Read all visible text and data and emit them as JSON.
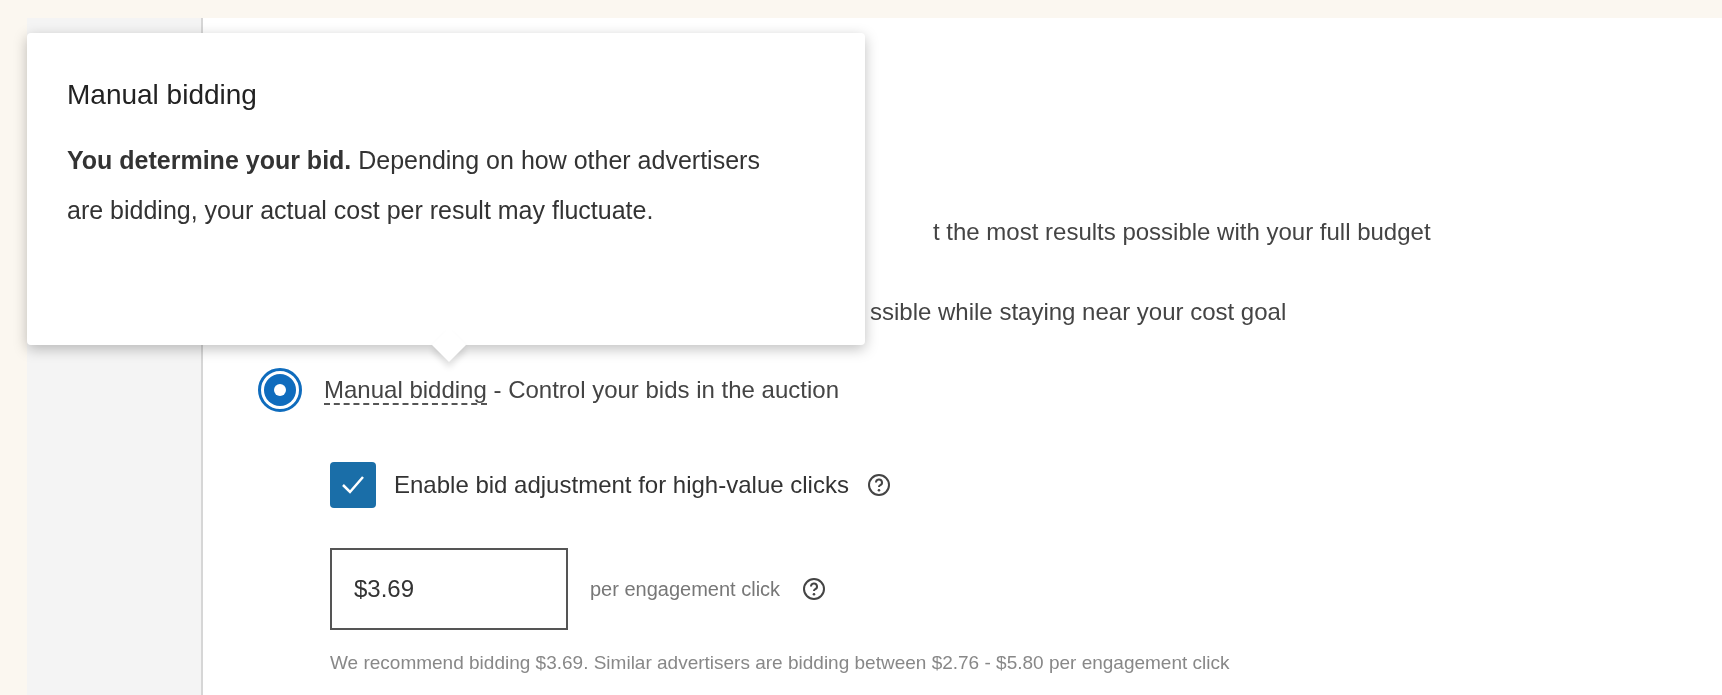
{
  "tooltip": {
    "title": "Manual bidding",
    "body": "**You determine your bid.** Depending on how other advertisers are bidding, your actual cost per result may fluctuate."
  },
  "obscured_options": [
    "t the most results possible with your full budget",
    "ssible while staying near your cost goal"
  ],
  "bid_strategy": {
    "selected": true,
    "label": "Manual bidding",
    "description": " - Control your bids in the auction"
  },
  "bid_adjustment": {
    "checked": true,
    "label": "Enable bid adjustment for high-value clicks"
  },
  "bid": {
    "value": "$3.69",
    "unit": "per engagement click"
  },
  "recommendation": "We recommend bidding $3.69. Similar advertisers are bidding between $2.76 - $5.80 per engagement click"
}
